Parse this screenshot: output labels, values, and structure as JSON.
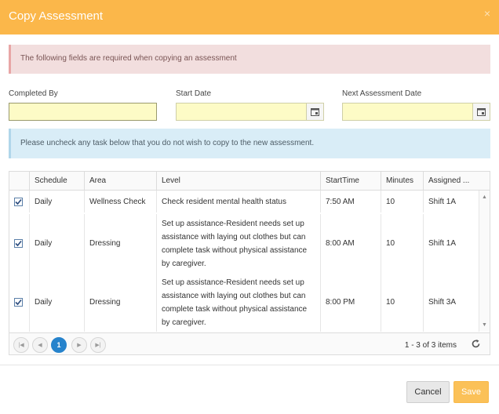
{
  "dialog": {
    "title": "Copy Assessment",
    "close_glyph": "×"
  },
  "alerts": {
    "required": "The following fields are required when copying an assessment",
    "info": "Please uncheck any task below that you do not wish to copy to the new assessment."
  },
  "fields": {
    "completed_by": {
      "label": "Completed By",
      "value": ""
    },
    "start_date": {
      "label": "Start Date",
      "value": ""
    },
    "next_assessment_date": {
      "label": "Next Assessment Date",
      "value": ""
    }
  },
  "grid": {
    "columns": [
      "Schedule",
      "Area",
      "Level",
      "StartTime",
      "Minutes",
      "Assigned ..."
    ],
    "rows": [
      {
        "checked": true,
        "schedule": "Daily",
        "area": "Wellness Check",
        "level": "Check resident mental health status",
        "start_time": "7:50 AM",
        "minutes": "10",
        "assigned": "Shift 1A"
      },
      {
        "checked": true,
        "schedule": "Daily",
        "area": "Dressing",
        "level": "Set up assistance-Resident needs set up assistance with laying out clothes but can complete task without physical assistance by caregiver.",
        "start_time": "8:00 AM",
        "minutes": "10",
        "assigned": "Shift 1A"
      },
      {
        "checked": true,
        "schedule": "Daily",
        "area": "Dressing",
        "level": "Set up assistance-Resident needs set up assistance with laying out clothes but can complete task without physical assistance by caregiver.",
        "start_time": "8:00 PM",
        "minutes": "10",
        "assigned": "Shift 3A"
      }
    ],
    "pager": {
      "current_page": "1",
      "info": "1 - 3 of 3 items"
    }
  },
  "footer": {
    "cancel_label": "Cancel",
    "save_label": "Save"
  },
  "colors": {
    "header": "#fbb74a",
    "required_bg": "#f2dede",
    "info_bg": "#d9edf7",
    "field_bg": "#fdfbc6",
    "pager_active": "#2683cc",
    "save_button": "#fbc158"
  }
}
